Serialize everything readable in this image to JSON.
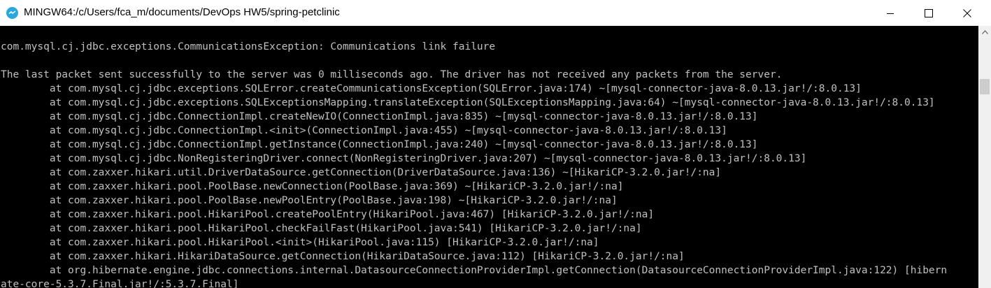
{
  "window": {
    "title": "MINGW64:/c/Users/fca_m/documents/DevOps HW5/spring-petclinic",
    "app_icon": "mintty-icon",
    "controls": {
      "minimize_icon": "minimize-icon",
      "maximize_icon": "maximize-icon",
      "close_icon": "close-icon"
    }
  },
  "colors": {
    "terminal_background": "#000000",
    "terminal_text": "#c0c0c0",
    "titlebar_background": "#ffffff",
    "app_icon_accent": "#29a8e0"
  },
  "terminal": {
    "lines": [
      "com.mysql.cj.jdbc.exceptions.CommunicationsException: Communications link failure",
      "",
      "The last packet sent successfully to the server was 0 milliseconds ago. The driver has not received any packets from the server.",
      "        at com.mysql.cj.jdbc.exceptions.SQLError.createCommunicationsException(SQLError.java:174) ~[mysql-connector-java-8.0.13.jar!/:8.0.13]",
      "        at com.mysql.cj.jdbc.exceptions.SQLExceptionsMapping.translateException(SQLExceptionsMapping.java:64) ~[mysql-connector-java-8.0.13.jar!/:8.0.13]",
      "        at com.mysql.cj.jdbc.ConnectionImpl.createNewIO(ConnectionImpl.java:835) ~[mysql-connector-java-8.0.13.jar!/:8.0.13]",
      "        at com.mysql.cj.jdbc.ConnectionImpl.<init>(ConnectionImpl.java:455) ~[mysql-connector-java-8.0.13.jar!/:8.0.13]",
      "        at com.mysql.cj.jdbc.ConnectionImpl.getInstance(ConnectionImpl.java:240) ~[mysql-connector-java-8.0.13.jar!/:8.0.13]",
      "        at com.mysql.cj.jdbc.NonRegisteringDriver.connect(NonRegisteringDriver.java:207) ~[mysql-connector-java-8.0.13.jar!/:8.0.13]",
      "        at com.zaxxer.hikari.util.DriverDataSource.getConnection(DriverDataSource.java:136) ~[HikariCP-3.2.0.jar!/:na]",
      "        at com.zaxxer.hikari.pool.PoolBase.newConnection(PoolBase.java:369) ~[HikariCP-3.2.0.jar!/:na]",
      "        at com.zaxxer.hikari.pool.PoolBase.newPoolEntry(PoolBase.java:198) ~[HikariCP-3.2.0.jar!/:na]",
      "        at com.zaxxer.hikari.pool.HikariPool.createPoolEntry(HikariPool.java:467) [HikariCP-3.2.0.jar!/:na]",
      "        at com.zaxxer.hikari.pool.HikariPool.checkFailFast(HikariPool.java:541) [HikariCP-3.2.0.jar!/:na]",
      "        at com.zaxxer.hikari.pool.HikariPool.<init>(HikariPool.java:115) [HikariCP-3.2.0.jar!/:na]",
      "        at com.zaxxer.hikari.HikariDataSource.getConnection(HikariDataSource.java:112) [HikariCP-3.2.0.jar!/:na]",
      "        at org.hibernate.engine.jdbc.connections.internal.DatasourceConnectionProviderImpl.getConnection(DatasourceConnectionProviderImpl.java:122) [hibern",
      "ate-core-5.3.7.Final.jar!/:5.3.7.Final]"
    ]
  },
  "scrollbar": {
    "up_icon": "scroll-up-arrow-icon"
  }
}
